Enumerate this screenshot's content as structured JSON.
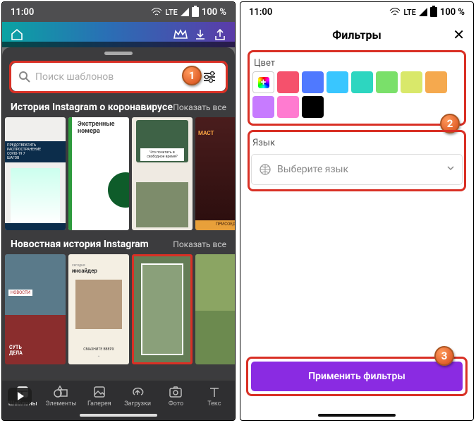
{
  "status": {
    "time": "11:00",
    "net": "LTE",
    "battery": "100 %"
  },
  "left": {
    "search_placeholder": "Поиск шаблонов",
    "section1_title": "История Instagram о коронавирусе",
    "section2_title": "Новостная история Instagram",
    "show_all": "Показать все",
    "tpl1_line1": "ПРЕДОТВРАТИТЬ",
    "tpl1_line2": "РАСПРОСТРАНЕНИЕ",
    "tpl1_line3": "COVID-19 7",
    "tpl1_line4": "ШАГОВ",
    "tpl2_title": "Экстренные",
    "tpl2_title2": "номера",
    "tpl3_cap": "Что почитать в",
    "tpl3_cap2": "свободное время?",
    "tpl4_txt": "МАСТ",
    "n1_tag": "НОВОСТИ",
    "n1_big": "СУТЬ",
    "n1_big2": "ДЕЛА",
    "n2_small": "сегодня",
    "n2_word": "инсайдер",
    "n2_swipe": "СМАХНИТЕ ВВЕРХ",
    "nav": [
      "Шаблоны",
      "Элементы",
      "Галерея",
      "Загрузки",
      "Фото",
      "Текс"
    ]
  },
  "right": {
    "title": "Фильтры",
    "color_label": "Цвет",
    "colors": [
      "#f5516c",
      "#4f79ff",
      "#39c6ff",
      "#2dd6c0",
      "#7ae06a",
      "#d9e86a",
      "#f5a94e",
      "#c77bff",
      "#ff7bd0",
      "#000000"
    ],
    "lang_label": "Язык",
    "lang_placeholder": "Выберите язык",
    "apply": "Применить фильтры"
  },
  "annotations": {
    "a1": "1",
    "a2": "2",
    "a3": "3"
  }
}
